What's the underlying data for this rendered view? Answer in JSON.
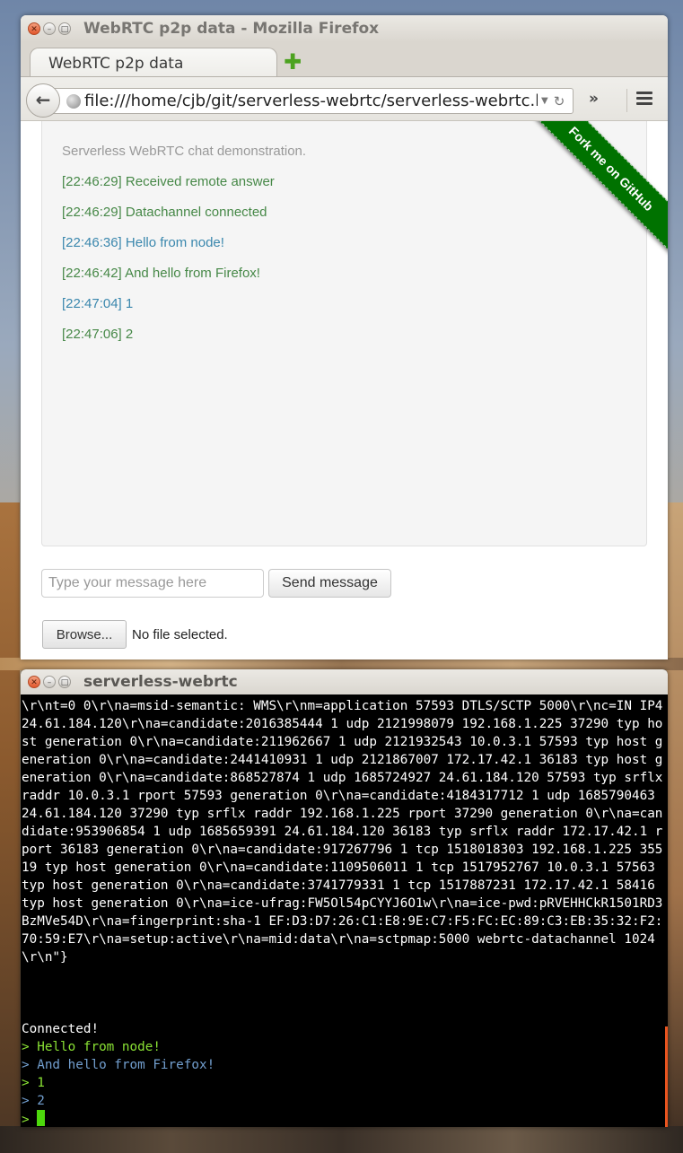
{
  "firefox": {
    "window_title": "WebRTC p2p data - Mozilla Firefox",
    "tab_label": "WebRTC p2p data",
    "new_tab_glyph": "✚",
    "url": "file:///home/cjb/git/serverless-webrtc/serverless-webrtc.h",
    "overflow_glyph": "»"
  },
  "page": {
    "intro": "Serverless WebRTC chat demonstration.",
    "messages": [
      {
        "text": "[22:46:29] Received remote answer",
        "kind": "local"
      },
      {
        "text": "[22:46:29] Datachannel connected",
        "kind": "local"
      },
      {
        "text": "[22:46:36] Hello from node!",
        "kind": "remote"
      },
      {
        "text": "[22:46:42] And hello from Firefox!",
        "kind": "local"
      },
      {
        "text": "[22:47:04] 1",
        "kind": "remote"
      },
      {
        "text": "[22:47:06] 2",
        "kind": "local"
      }
    ],
    "ribbon": "Fork me on GitHub",
    "message_placeholder": "Type your message here",
    "send_label": "Send message",
    "browse_label": "Browse...",
    "file_status": "No file selected."
  },
  "terminal": {
    "window_title": "serverless-webrtc",
    "sdp_dump": "\\r\\nt=0 0\\r\\na=msid-semantic: WMS\\r\\nm=application 57593 DTLS/SCTP 5000\\r\\nc=IN IP4 24.61.184.120\\r\\na=candidate:2016385444 1 udp 2121998079 192.168.1.225 37290 typ host generation 0\\r\\na=candidate:211962667 1 udp 2121932543 10.0.3.1 57593 typ host generation 0\\r\\na=candidate:2441410931 1 udp 2121867007 172.17.42.1 36183 typ host generation 0\\r\\na=candidate:868527874 1 udp 1685724927 24.61.184.120 57593 typ srflx raddr 10.0.3.1 rport 57593 generation 0\\r\\na=candidate:4184317712 1 udp 1685790463 24.61.184.120 37290 typ srflx raddr 192.168.1.225 rport 37290 generation 0\\r\\na=candidate:953906854 1 udp 1685659391 24.61.184.120 36183 typ srflx raddr 172.17.42.1 rport 36183 generation 0\\r\\na=candidate:917267796 1 tcp 1518018303 192.168.1.225 35519 typ host generation 0\\r\\na=candidate:1109506011 1 tcp 1517952767 10.0.3.1 57563 typ host generation 0\\r\\na=candidate:3741779331 1 tcp 1517887231 172.17.42.1 58416 typ host generation 0\\r\\na=ice-ufrag:FW5Ol54pCYYJ6O1w\\r\\na=ice-pwd:pRVEHHCkR1501RD3BzMVe54D\\r\\na=fingerprint:sha-1 EF:D3:D7:26:C1:E8:9E:C7:F5:FC:EC:89:C3:EB:35:32:F2:70:59:E7\\r\\na=setup:active\\r\\na=mid:data\\r\\na=sctpmap:5000 webrtc-datachannel 1024\\r\\n\"}",
    "connected": "Connected!",
    "lines": [
      {
        "text": "> Hello from node!",
        "color": "green"
      },
      {
        "text": "> And hello from Firefox!",
        "color": "blue"
      },
      {
        "text": "> 1",
        "color": "green"
      },
      {
        "text": "> 2",
        "color": "blue"
      }
    ],
    "prompt": ">"
  },
  "colors": {
    "local_message": "#468847",
    "remote_message": "#3a87ad",
    "ribbon": "#007200",
    "terminal_green": "#8ae234",
    "terminal_blue": "#3465a4"
  }
}
